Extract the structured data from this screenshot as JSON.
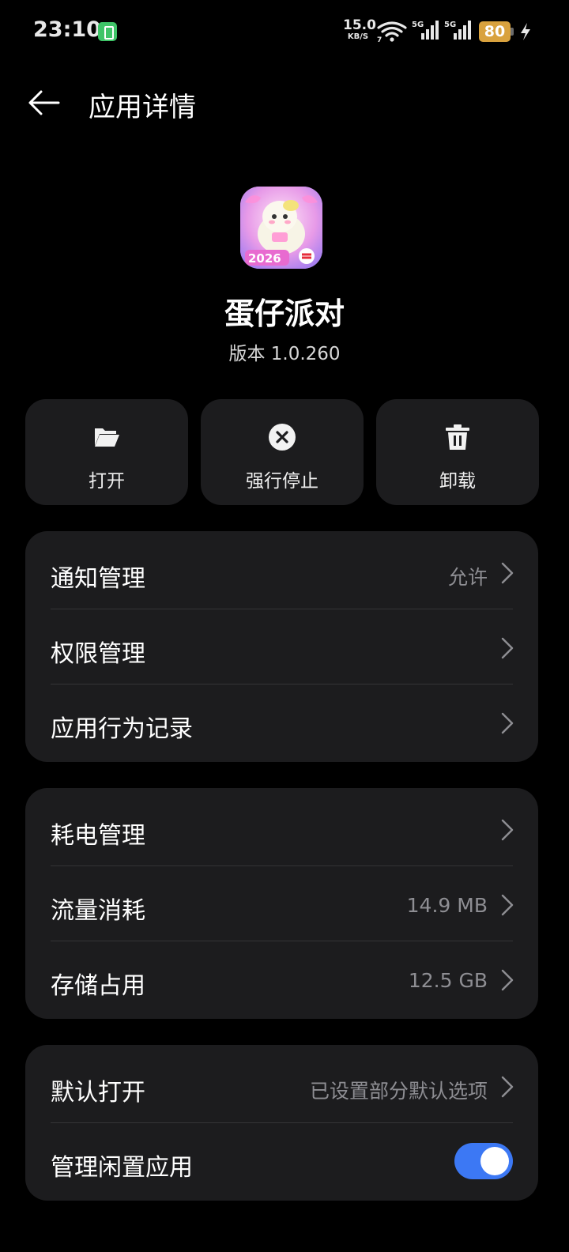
{
  "status_bar": {
    "time": "23:10",
    "net_speed_value": "15.0",
    "net_speed_unit": "KB/S",
    "signal1_label": "5G",
    "signal2_label": "5G",
    "battery_level": "80",
    "colors": {
      "battery": "#d9a23e",
      "battery_saver": "#3fc468"
    }
  },
  "header": {
    "title": "应用详情"
  },
  "app": {
    "name": "蛋仔派对",
    "version": "版本 1.0.260",
    "icon": "app-icon-eggy-party"
  },
  "actions": [
    {
      "label": "打开",
      "icon": "folder-open-icon"
    },
    {
      "label": "强行停止",
      "icon": "force-stop-icon"
    },
    {
      "label": "卸载",
      "icon": "trash-icon"
    }
  ],
  "group1": {
    "notifications": {
      "label": "通知管理",
      "value": "允许"
    },
    "permissions": {
      "label": "权限管理"
    },
    "behavior_log": {
      "label": "应用行为记录"
    }
  },
  "group2": {
    "battery": {
      "label": "耗电管理"
    },
    "data_usage": {
      "label": "流量消耗",
      "value": "14.9 MB"
    },
    "storage": {
      "label": "存储占用",
      "value": "12.5 GB"
    }
  },
  "group3": {
    "default_open": {
      "label": "默认打开",
      "value": "已设置部分默认选项"
    },
    "idle_apps": {
      "label": "管理闲置应用",
      "enabled": true
    }
  },
  "colors": {
    "background": "#000000",
    "card": "#1c1c1e",
    "secondary_text": "#8e8e93",
    "toggle_on": "#3c78f4"
  }
}
